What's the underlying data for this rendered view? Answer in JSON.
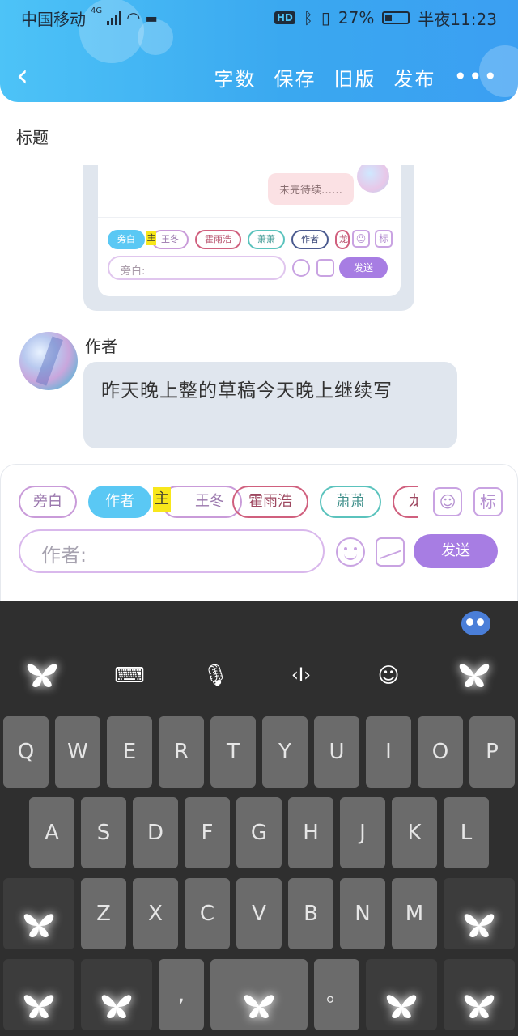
{
  "status_bar": {
    "carrier": "中国移动",
    "network": "4G",
    "battery_percent": "27%",
    "time": "半夜11:23"
  },
  "header": {
    "back_icon": "chevron-left-icon",
    "actions": [
      "字数",
      "保存",
      "旧版",
      "发布"
    ],
    "more_icon": "more-dots-icon"
  },
  "title_label": "标题",
  "preview": {
    "bubble_text": "未完待续……",
    "chips": [
      "旁白",
      "王冬",
      "霍雨浩",
      "萧萧",
      "作者",
      "龙"
    ],
    "chip_flag": "主",
    "icon_avatar": "avatar-card-icon",
    "icon_mark": "标",
    "input_placeholder": "旁白:",
    "send_label": "发送"
  },
  "message": {
    "author": "作者",
    "text": "昨天晚上整的草稿今天晚上继续写"
  },
  "composer": {
    "chips": [
      {
        "label": "旁白",
        "active": false
      },
      {
        "label": "作者",
        "active": true
      },
      {
        "label": "王冬",
        "active": false
      },
      {
        "label": "霍雨浩",
        "active": false
      },
      {
        "label": "萧萧",
        "active": false
      },
      {
        "label": "龙",
        "active": false
      }
    ],
    "chip_flag": "主",
    "side_icons": [
      "avatar-card-icon",
      "标"
    ],
    "input_placeholder": "作者:",
    "send_label": "发送"
  },
  "keyboard": {
    "toolbar": [
      "butterfly-icon",
      "keyboard-icon",
      "microphone-icon",
      "cursor-icon",
      "emoji-icon",
      "butterfly-icon"
    ],
    "row1": [
      "Q",
      "W",
      "E",
      "R",
      "T",
      "Y",
      "U",
      "I",
      "O",
      "P"
    ],
    "row2": [
      "A",
      "S",
      "D",
      "F",
      "G",
      "H",
      "J",
      "K",
      "L"
    ],
    "row3": [
      "Z",
      "X",
      "C",
      "V",
      "B",
      "N",
      "M"
    ],
    "row4_comma": ",",
    "row4_period": "。"
  }
}
